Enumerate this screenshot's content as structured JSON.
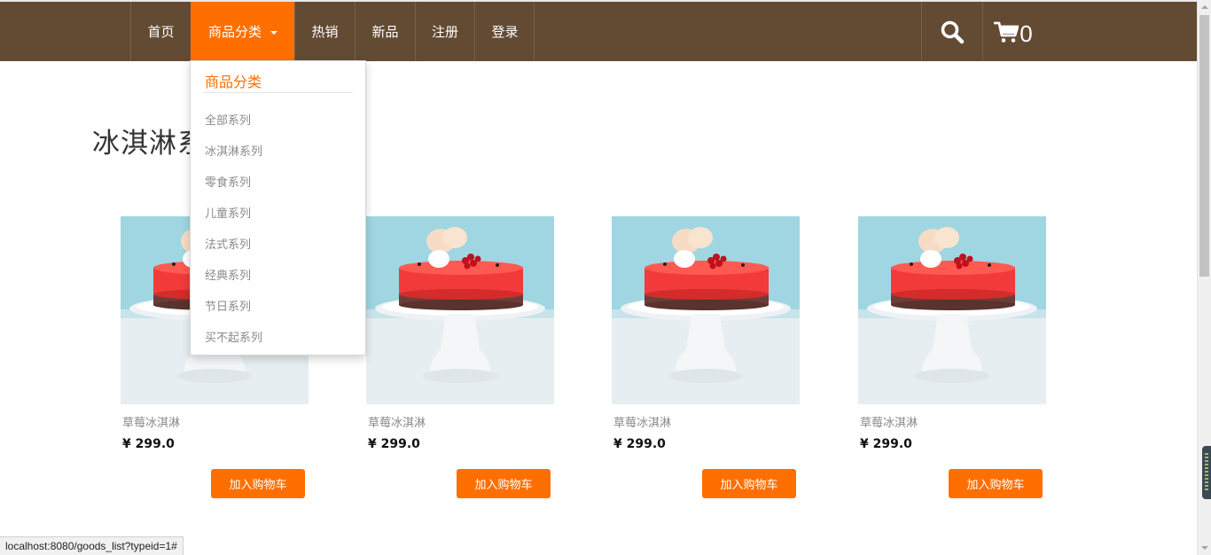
{
  "nav": {
    "items": [
      "首页",
      "商品分类",
      "热销",
      "新品",
      "注册",
      "登录"
    ],
    "cart_count": "0"
  },
  "dropdown": {
    "header": "商品分类",
    "items": [
      "全部系列",
      "冰淇淋系列",
      "零食系列",
      "儿童系列",
      "法式系列",
      "经典系列",
      "节日系列",
      "买不起系列"
    ]
  },
  "section": {
    "title": "冰淇淋系列"
  },
  "products": [
    {
      "name": "草莓冰淇淋",
      "price": "¥ 299.0",
      "button": "加入购物车"
    },
    {
      "name": "草莓冰淇淋",
      "price": "¥ 299.0",
      "button": "加入购物车"
    },
    {
      "name": "草莓冰淇淋",
      "price": "¥ 299.0",
      "button": "加入购物车"
    },
    {
      "name": "草莓冰淇淋",
      "price": "¥ 299.0",
      "button": "加入购物车"
    }
  ],
  "status_bar": "localhost:8080/goods_list?typeid=1#",
  "colors": {
    "nav_bg": "#634a33",
    "accent": "#ff6f00"
  },
  "icons": [
    "search-icon",
    "cart-icon"
  ]
}
